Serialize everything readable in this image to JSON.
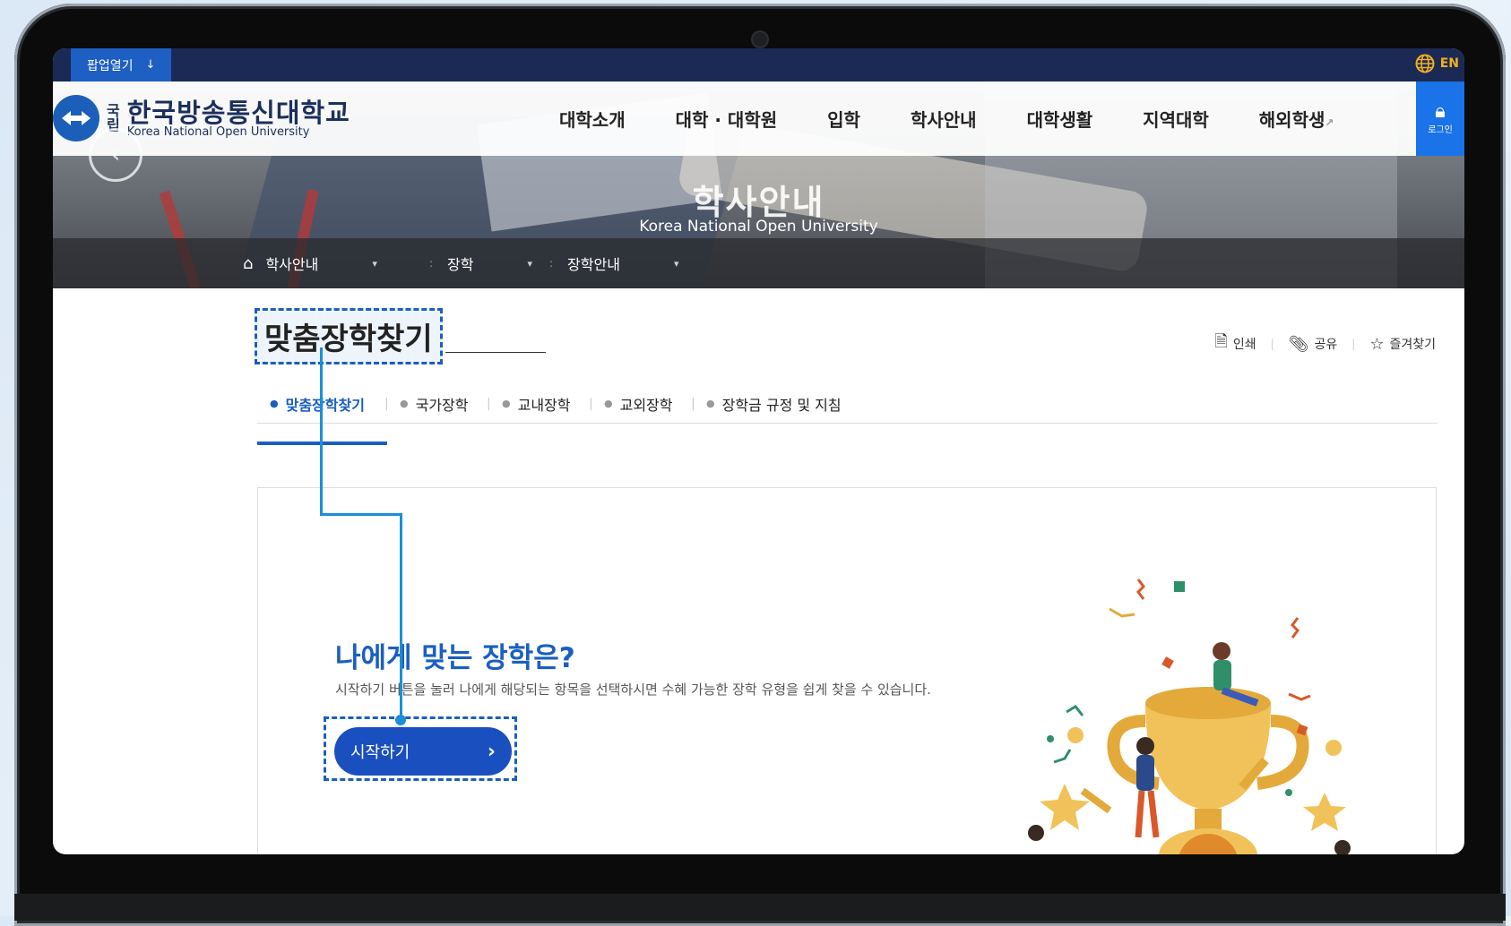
{
  "topbar": {
    "popup_label": "팝업열기",
    "popup_arrow": "↓",
    "lang_label": "EN"
  },
  "header": {
    "logo_small_1": "국",
    "logo_small_2": "립",
    "logo_kor": "한국방송통신대학교",
    "logo_eng": "Korea National Open University",
    "nav": [
      "대학소개",
      "대학 · 대학원",
      "입학",
      "학사안내",
      "대학생활",
      "지역대학",
      "해외학생"
    ],
    "login_label": "로그인"
  },
  "hero": {
    "title": "학사안내",
    "subtitle": "Korea National Open University"
  },
  "breadcrumb": [
    "학사안내",
    "장학",
    "장학안내"
  ],
  "page": {
    "title": "맞춤장학찾기",
    "utils": [
      "인쇄",
      "공유",
      "즐겨찾기"
    ]
  },
  "tabs": [
    "맞춤장학찾기",
    "국가장학",
    "교내장학",
    "교외장학",
    "장학금 규정 및 지침"
  ],
  "card": {
    "heading": "나에게 맞는 장학은?",
    "description": "시작하기 버튼을 눌러 나에게 해당되는 항목을 선택하시면 수혜 가능한 장학 유형을 쉽게 찾을 수 있습니다.",
    "start_label": "시작하기"
  },
  "colors": {
    "accent": "#1a5fc0",
    "topbar": "#1a2a55",
    "connector": "#1a8fd8"
  }
}
